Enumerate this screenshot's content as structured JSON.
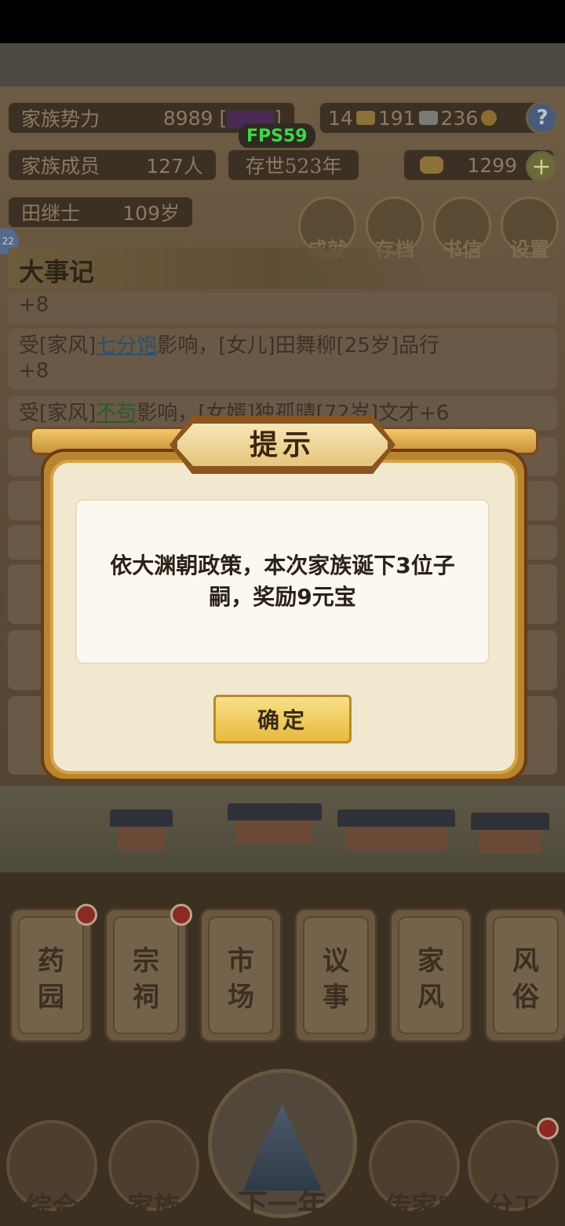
{
  "hud": {
    "power_label": "家族势力",
    "power_value": "8989",
    "power_rank_open": "[",
    "power_rank_close": "]",
    "currency_gold": "14",
    "currency_silver": "191",
    "currency_coin": "236",
    "help_label": "?",
    "members_label": "家族成员",
    "members_value": "127人",
    "age_label": "存世523年",
    "ingot_value": "1299",
    "plus_label": "+",
    "head_name": "田继士",
    "head_age": "109岁",
    "fps": "FPS59",
    "side_badge": "22"
  },
  "top_menu": [
    {
      "label": "成就"
    },
    {
      "label": "存档"
    },
    {
      "label": "书信"
    },
    {
      "label": "设置"
    }
  ],
  "events": {
    "title": "大事记",
    "line0": "+8",
    "line1_a": "受[家风]",
    "line1_link": "七分饱",
    "line1_b": "影响，[女儿]田舞柳[25岁]品行",
    "line1_c": "+8",
    "line2_a": "受[家风]",
    "line2_link": "不苟",
    "line2_b": "影响，[女婿]独孤晴[72岁]文才+6"
  },
  "dialog": {
    "title": "提示",
    "message": "依大渊朝政策，本次家族诞下3位子嗣，奖励9元宝",
    "confirm": "确定"
  },
  "buildings": [
    {
      "label": "药园"
    },
    {
      "label": "宗祠"
    },
    {
      "label": "市场"
    },
    {
      "label": "议事"
    },
    {
      "label": "家风"
    },
    {
      "label": "风俗"
    }
  ],
  "bottom_nav": {
    "general": "综合",
    "family": "家族",
    "next_year": "下一年",
    "heirloom": "传家宝",
    "division": "分工"
  },
  "colors": {
    "dialog_frame": "#b8842e",
    "dialog_paper": "#f2e8cf",
    "button_gold": "#e8b93e",
    "fps_green": "#3fd64b"
  }
}
